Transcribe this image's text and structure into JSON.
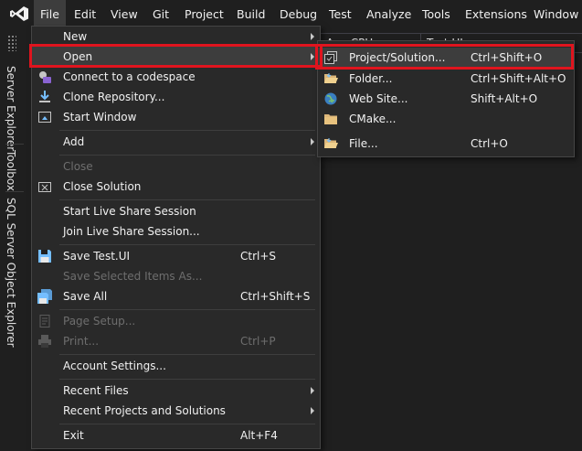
{
  "menubar": {
    "items": [
      "File",
      "Edit",
      "View",
      "Git",
      "Project",
      "Build",
      "Debug",
      "Test",
      "Analyze",
      "Tools",
      "Extensions",
      "Window"
    ]
  },
  "toolbar": {
    "platform": "Any CPU",
    "project": "Test.UI"
  },
  "sidebar": {
    "tabs": [
      "Server Explorer",
      "Toolbox",
      "SQL Server Object Explorer"
    ]
  },
  "file_menu": {
    "new": "New",
    "open": "Open",
    "connect_codespace": "Connect to a codespace",
    "clone_repository": "Clone Repository...",
    "start_window": "Start Window",
    "add": "Add",
    "close": "Close",
    "close_solution": "Close Solution",
    "start_live_share": "Start Live Share Session",
    "join_live_share": "Join Live Share Session...",
    "save": "Save Test.UI",
    "save_shortcut": "Ctrl+S",
    "save_selected_as": "Save Selected Items As...",
    "save_all": "Save All",
    "save_all_shortcut": "Ctrl+Shift+S",
    "page_setup": "Page Setup...",
    "print": "Print...",
    "print_shortcut": "Ctrl+P",
    "account_settings": "Account Settings...",
    "recent_files": "Recent Files",
    "recent_projects": "Recent Projects and Solutions",
    "exit": "Exit",
    "exit_shortcut": "Alt+F4"
  },
  "open_submenu": {
    "project_solution": "Project/Solution...",
    "project_solution_shortcut": "Ctrl+Shift+O",
    "folder": "Folder...",
    "folder_shortcut": "Ctrl+Shift+Alt+O",
    "website": "Web Site...",
    "website_shortcut": "Shift+Alt+O",
    "cmake": "CMake...",
    "file": "File...",
    "file_shortcut": "Ctrl+O"
  },
  "colors": {
    "accent": "#68217a",
    "highlight": "#e0141e",
    "background": "#1f1f1f",
    "menu": "#292929"
  }
}
